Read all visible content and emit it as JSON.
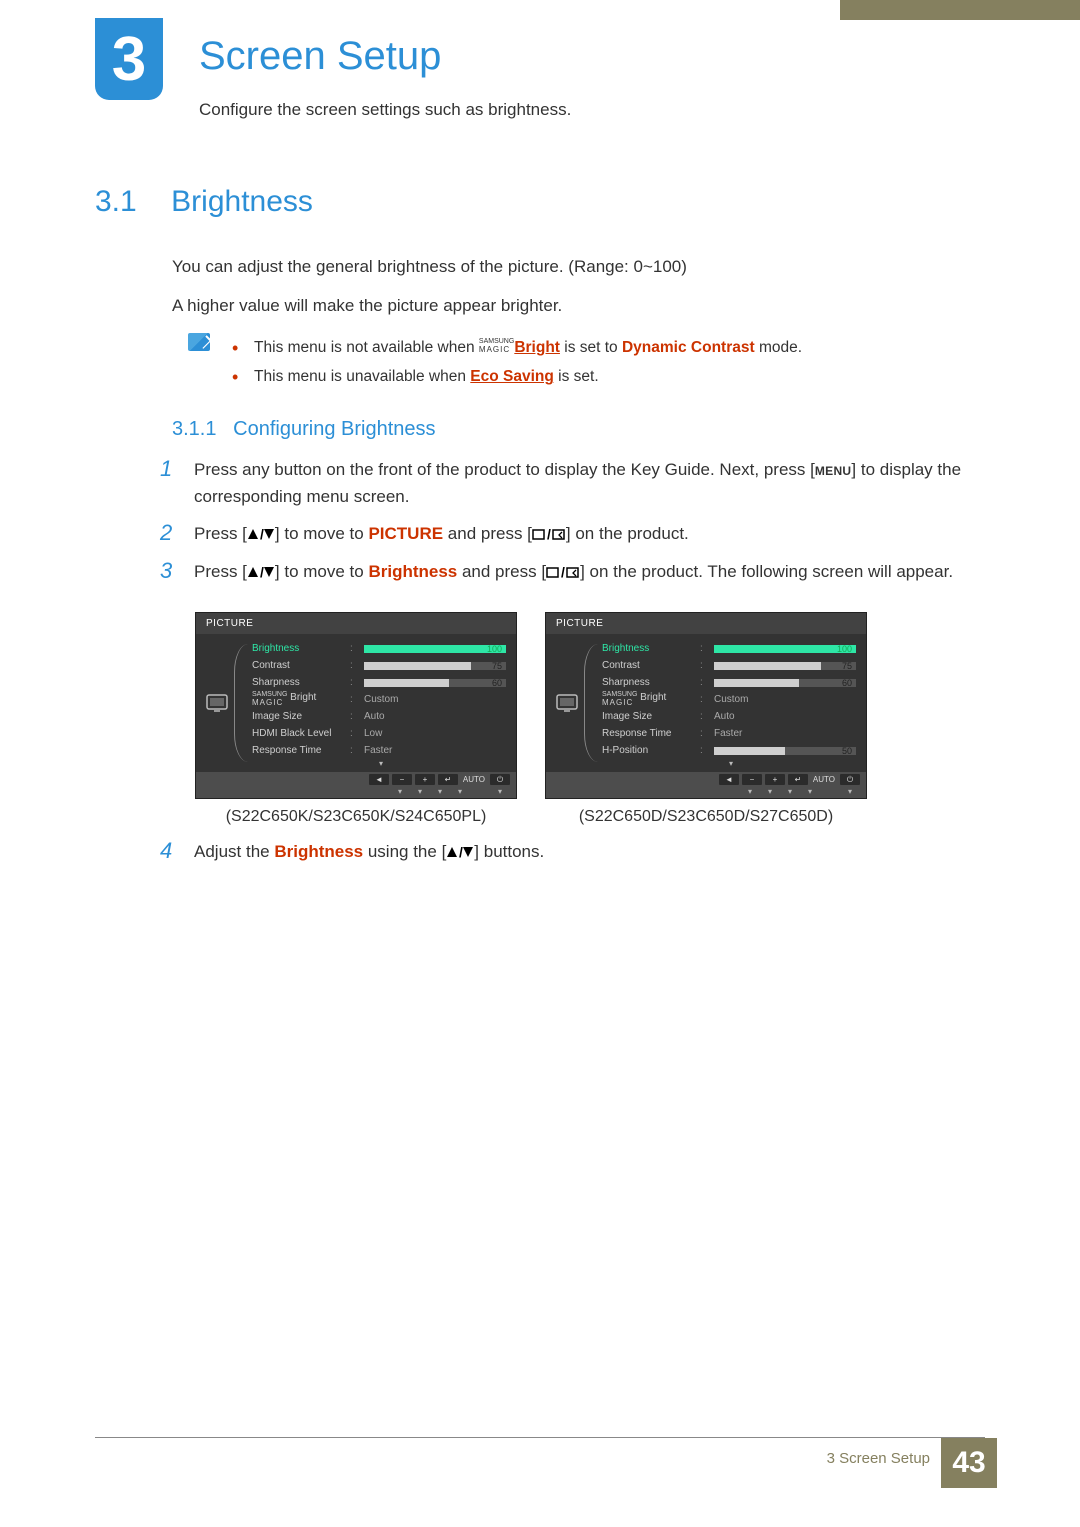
{
  "chapter": {
    "number": "3",
    "title": "Screen Setup",
    "subtitle": "Configure the screen settings such as brightness."
  },
  "section": {
    "number": "3.1",
    "title": "Brightness"
  },
  "body": {
    "p1": "You can adjust the general brightness of the picture. (Range: 0~100)",
    "p2": "A higher value will make the picture appear brighter."
  },
  "notes": {
    "line1_a": "This menu is not available when ",
    "line1_magic_top": "SAMSUNG",
    "line1_magic_bot": "MAGIC",
    "line1_bright": "Bright",
    "line1_b": " is set to ",
    "line1_dc": "Dynamic Contrast",
    "line1_c": " mode.",
    "line2_a": "This menu is unavailable when ",
    "line2_eco": "Eco Saving",
    "line2_b": " is set."
  },
  "subsection": {
    "number": "3.1.1",
    "title": "Configuring Brightness"
  },
  "steps": {
    "s1a": "Press any button on the front of the product to display the Key Guide. Next, press [",
    "s1menu": "MENU",
    "s1b": "] to display the corresponding menu screen.",
    "s2a": "Press [",
    "s2b": "] to move to ",
    "s2pic": "PICTURE",
    "s2c": " and press [",
    "s2d": "] on the product.",
    "s3a": "Press [",
    "s3b": "] to move to ",
    "s3bri": "Brightness",
    "s3c": " and press [",
    "s3d": "] on the product. The following screen will appear.",
    "s4a": "Adjust the ",
    "s4bri": "Brightness",
    "s4b": " using the [",
    "s4c": "] buttons."
  },
  "osd": {
    "header": "PICTURE",
    "footer_auto": "AUTO",
    "left": {
      "caption": "(S22C650K/S23C650K/S24C650PL)",
      "items": [
        {
          "label": "Brightness",
          "type": "bar",
          "value": 100,
          "fill": 100,
          "hl": true
        },
        {
          "label": "Contrast",
          "type": "bar",
          "value": 75,
          "fill": 75,
          "grey": true
        },
        {
          "label": "Sharpness",
          "type": "bar",
          "value": 60,
          "fill": 60,
          "grey": true
        },
        {
          "label": "MAGIC Bright",
          "type": "text",
          "value": "Custom",
          "magic": true
        },
        {
          "label": "Image Size",
          "type": "text",
          "value": "Auto"
        },
        {
          "label": "HDMI Black Level",
          "type": "text",
          "value": "Low"
        },
        {
          "label": "Response Time",
          "type": "text",
          "value": "Faster"
        }
      ]
    },
    "right": {
      "caption": "(S22C650D/S23C650D/S27C650D)",
      "items": [
        {
          "label": "Brightness",
          "type": "bar",
          "value": 100,
          "fill": 100,
          "hl": true
        },
        {
          "label": "Contrast",
          "type": "bar",
          "value": 75,
          "fill": 75,
          "grey": true
        },
        {
          "label": "Sharpness",
          "type": "bar",
          "value": 60,
          "fill": 60,
          "grey": true
        },
        {
          "label": "MAGIC Bright",
          "type": "text",
          "value": "Custom",
          "magic": true
        },
        {
          "label": "Image Size",
          "type": "text",
          "value": "Auto"
        },
        {
          "label": "Response Time",
          "type": "text",
          "value": "Faster"
        },
        {
          "label": "H-Position",
          "type": "bar",
          "value": 50,
          "fill": 50,
          "grey": true
        }
      ]
    }
  },
  "footer": {
    "text": "3 Screen Setup",
    "page": "43"
  }
}
